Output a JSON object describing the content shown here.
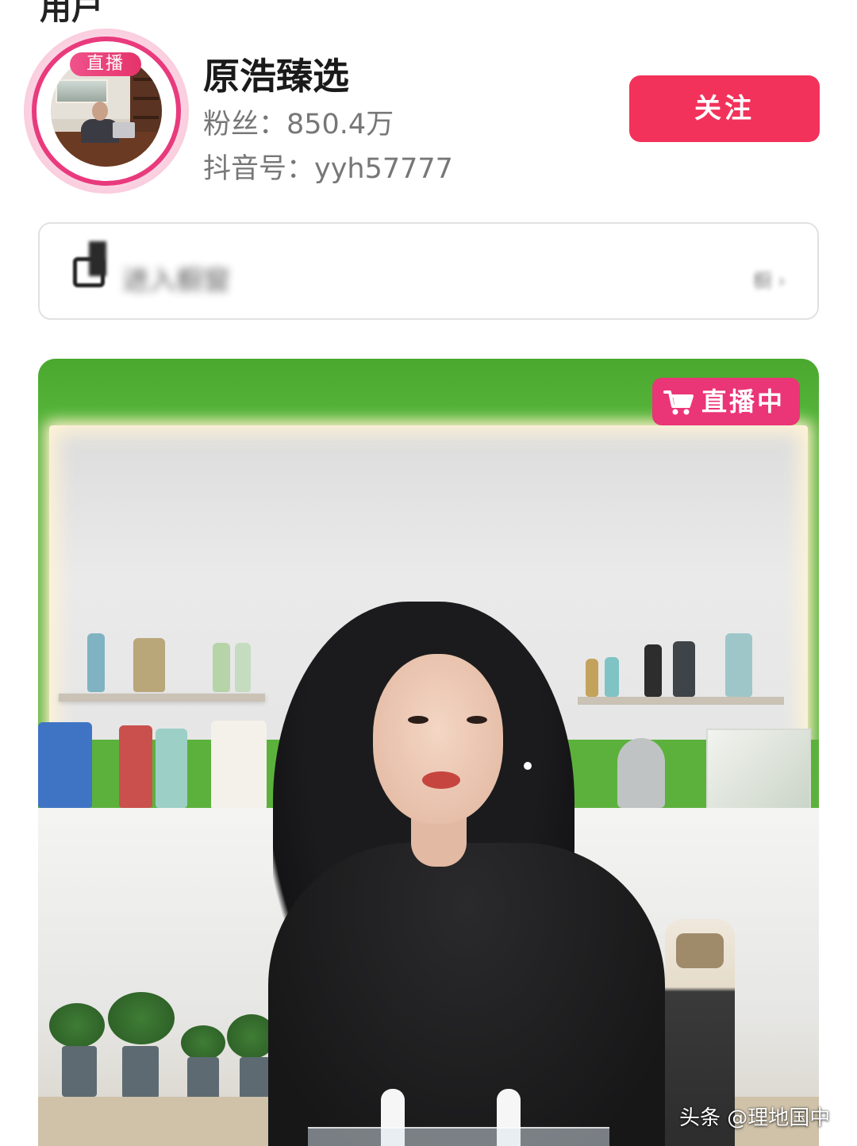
{
  "header": {
    "top_remnant": "用户"
  },
  "profile": {
    "live_tag": "直播",
    "name": "原浩臻选",
    "fans": "粉丝：850.4万",
    "douyin_id": "抖音号：yyh57777",
    "follow_label": "关注"
  },
  "info_bar": {
    "text": "进入橱窗",
    "right_text": "橱"
  },
  "live_card": {
    "badge_label": "直播中",
    "badge_icon": "shopping-cart-icon"
  },
  "watermark": {
    "text": "头条 @理地国中"
  },
  "colors": {
    "accent_red": "#f2325a",
    "live_pink": "#ea3576",
    "ring_pink": "#e93a7d"
  }
}
